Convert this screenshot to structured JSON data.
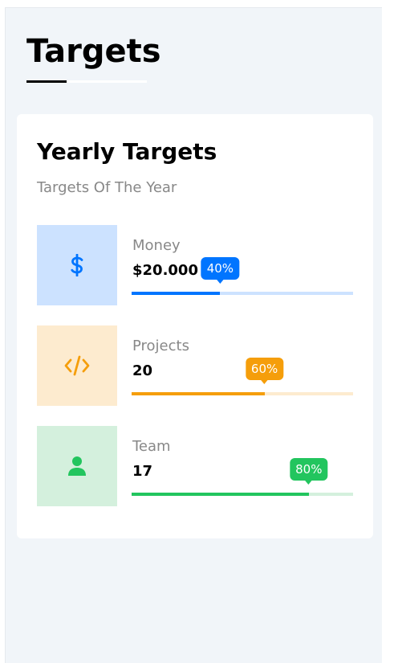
{
  "page": {
    "title": "Targets"
  },
  "card": {
    "title": "Yearly Targets",
    "subtitle": "Targets Of The Year"
  },
  "targets": [
    {
      "label": "Money",
      "value": "$20.000",
      "percent_label": "40%",
      "percent": 40,
      "icon": "dollar-icon",
      "color": "#0075ff",
      "light": "#cce2ff"
    },
    {
      "label": "Projects",
      "value": "20",
      "percent_label": "60%",
      "percent": 60,
      "icon": "code-icon",
      "color": "#f59e0b",
      "light": "#fdebcf"
    },
    {
      "label": "Team",
      "value": "17",
      "percent_label": "80%",
      "percent": 80,
      "icon": "user-icon",
      "color": "#22c55e",
      "light": "#d4f0dd"
    }
  ]
}
